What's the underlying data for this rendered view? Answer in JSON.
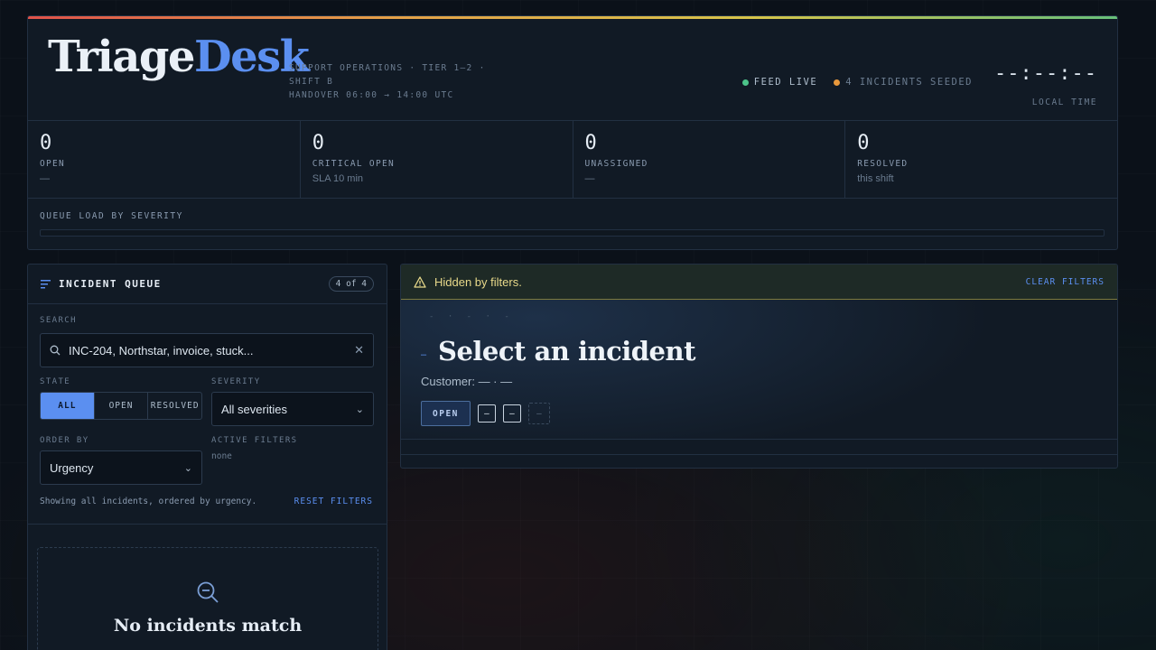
{
  "brand": {
    "name_part1": "Triage",
    "name_part2": "Desk"
  },
  "tagline": {
    "line1": "SUPPORT OPERATIONS · TIER 1–2 ·",
    "line2": "SHIFT B",
    "line3": "HANDOVER 06:00 → 14:00 UTC"
  },
  "status": {
    "feed": "FEED LIVE",
    "seeded": "4 INCIDENTS SEEDED",
    "feed_color": "#4cc48a",
    "seeded_color": "#e8983c"
  },
  "clock": {
    "time": "--:--:--",
    "label": "LOCAL TIME"
  },
  "stats": [
    {
      "value": "0",
      "label": "OPEN",
      "sub": "—"
    },
    {
      "value": "0",
      "label": "CRITICAL OPEN",
      "sub": "SLA 10 min"
    },
    {
      "value": "0",
      "label": "UNASSIGNED",
      "sub": "—"
    },
    {
      "value": "0",
      "label": "RESOLVED",
      "sub": "this shift"
    }
  ],
  "queue_load": {
    "label": "QUEUE LOAD BY SEVERITY"
  },
  "queue": {
    "title": "INCIDENT QUEUE",
    "count": "4 of 4",
    "search_label": "SEARCH",
    "search_value": "INC-204, Northstar, invoice, stuck...",
    "state_label": "STATE",
    "state_options": [
      "ALL",
      "OPEN",
      "RESOLVED"
    ],
    "severity_label": "SEVERITY",
    "severity_value": "All severities",
    "order_label": "ORDER BY",
    "order_value": "Urgency",
    "active_filters_label": "ACTIVE FILTERS",
    "active_filters_value": "none",
    "showing": "Showing all incidents, ordered by urgency.",
    "reset": "RESET FILTERS",
    "empty_title": "No incidents match"
  },
  "detail": {
    "banner_msg": "Hidden by filters.",
    "clear": "CLEAR FILTERS",
    "crumbs": "- · - · -",
    "dash": "–",
    "title": "Select an incident",
    "customer": "Customer: — · —",
    "tag_open": "OPEN",
    "tag_a": "–",
    "tag_b": "–",
    "tag_c": "–"
  }
}
